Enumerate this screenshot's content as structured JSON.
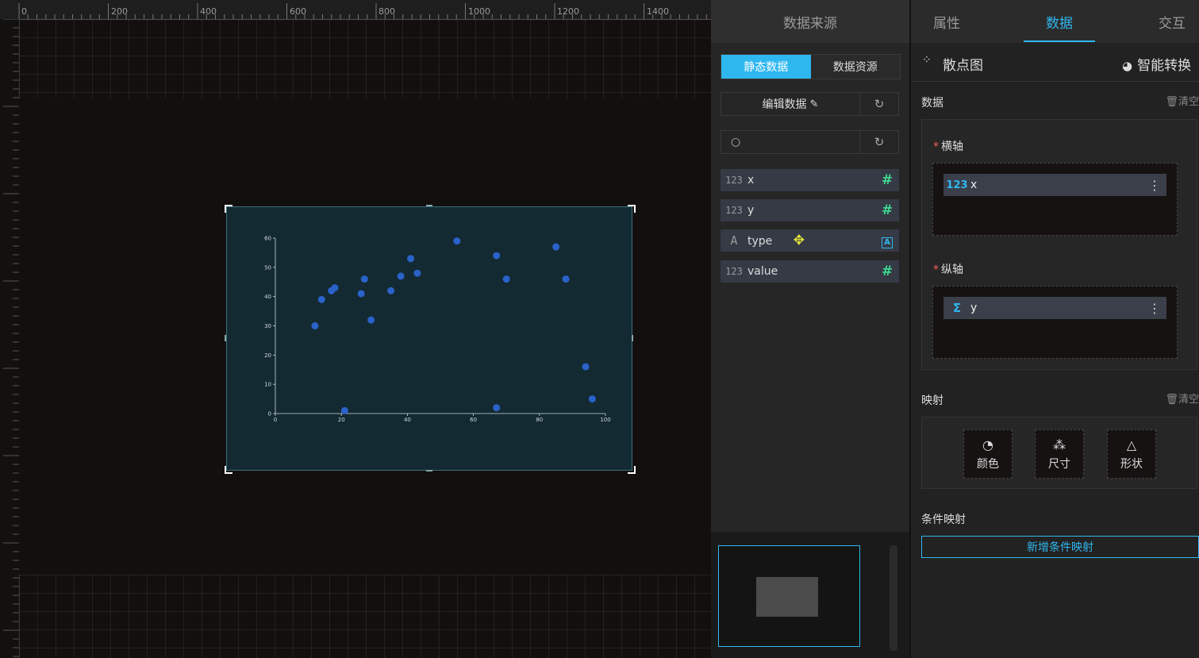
{
  "canvas": {
    "ruler_labels": [
      "0",
      "200",
      "400",
      "600",
      "800",
      "1000",
      "1200",
      "1400"
    ]
  },
  "data_source_panel": {
    "title": "数据来源",
    "toggle": [
      "静态数据",
      "数据资源"
    ],
    "edit_data_label": "编辑数据",
    "search_placeholder": "",
    "fields": [
      {
        "type_icon": "123",
        "label": "x",
        "kind": "number"
      },
      {
        "type_icon": "123",
        "label": "y",
        "kind": "number"
      },
      {
        "type_icon": "A",
        "label": "type",
        "kind": "text"
      },
      {
        "type_icon": "123",
        "label": "value",
        "kind": "number"
      }
    ]
  },
  "right_panel": {
    "tabs": [
      "属性",
      "数据",
      "交互"
    ],
    "active_tab": "数据",
    "chart_type": "散点图",
    "smart_convert": "智能转换",
    "data_section": "数据",
    "clear": "清空",
    "x_axis_label": "横轴",
    "x_axis_field": {
      "icon": "123",
      "label": "x"
    },
    "y_axis_label": "纵轴",
    "y_axis_field": {
      "icon": "Σ",
      "label": "y"
    },
    "mapping_section": "映射",
    "mapping_buttons": [
      "颜色",
      "尺寸",
      "形状"
    ],
    "condition_section": "条件映射",
    "add_condition": "新增条件映射"
  },
  "chart_data": {
    "type": "scatter",
    "xlim": [
      0,
      100
    ],
    "ylim": [
      0,
      60
    ],
    "x_ticks": [
      "0",
      "20",
      "40",
      "60",
      "80",
      "100"
    ],
    "y_ticks": [
      "0",
      "10",
      "20",
      "30",
      "40",
      "50",
      "60"
    ],
    "points": [
      {
        "x": 12,
        "y": 30
      },
      {
        "x": 14,
        "y": 39
      },
      {
        "x": 17,
        "y": 42
      },
      {
        "x": 18,
        "y": 43
      },
      {
        "x": 21,
        "y": 1
      },
      {
        "x": 26,
        "y": 41
      },
      {
        "x": 27,
        "y": 46
      },
      {
        "x": 29,
        "y": 32
      },
      {
        "x": 35,
        "y": 42
      },
      {
        "x": 38,
        "y": 47
      },
      {
        "x": 41,
        "y": 53
      },
      {
        "x": 43,
        "y": 48
      },
      {
        "x": 55,
        "y": 59
      },
      {
        "x": 67,
        "y": 54
      },
      {
        "x": 67,
        "y": 2
      },
      {
        "x": 70,
        "y": 46
      },
      {
        "x": 85,
        "y": 57
      },
      {
        "x": 88,
        "y": 46
      },
      {
        "x": 94,
        "y": 16
      },
      {
        "x": 96,
        "y": 5
      }
    ],
    "point_color": "#2a62c9"
  }
}
